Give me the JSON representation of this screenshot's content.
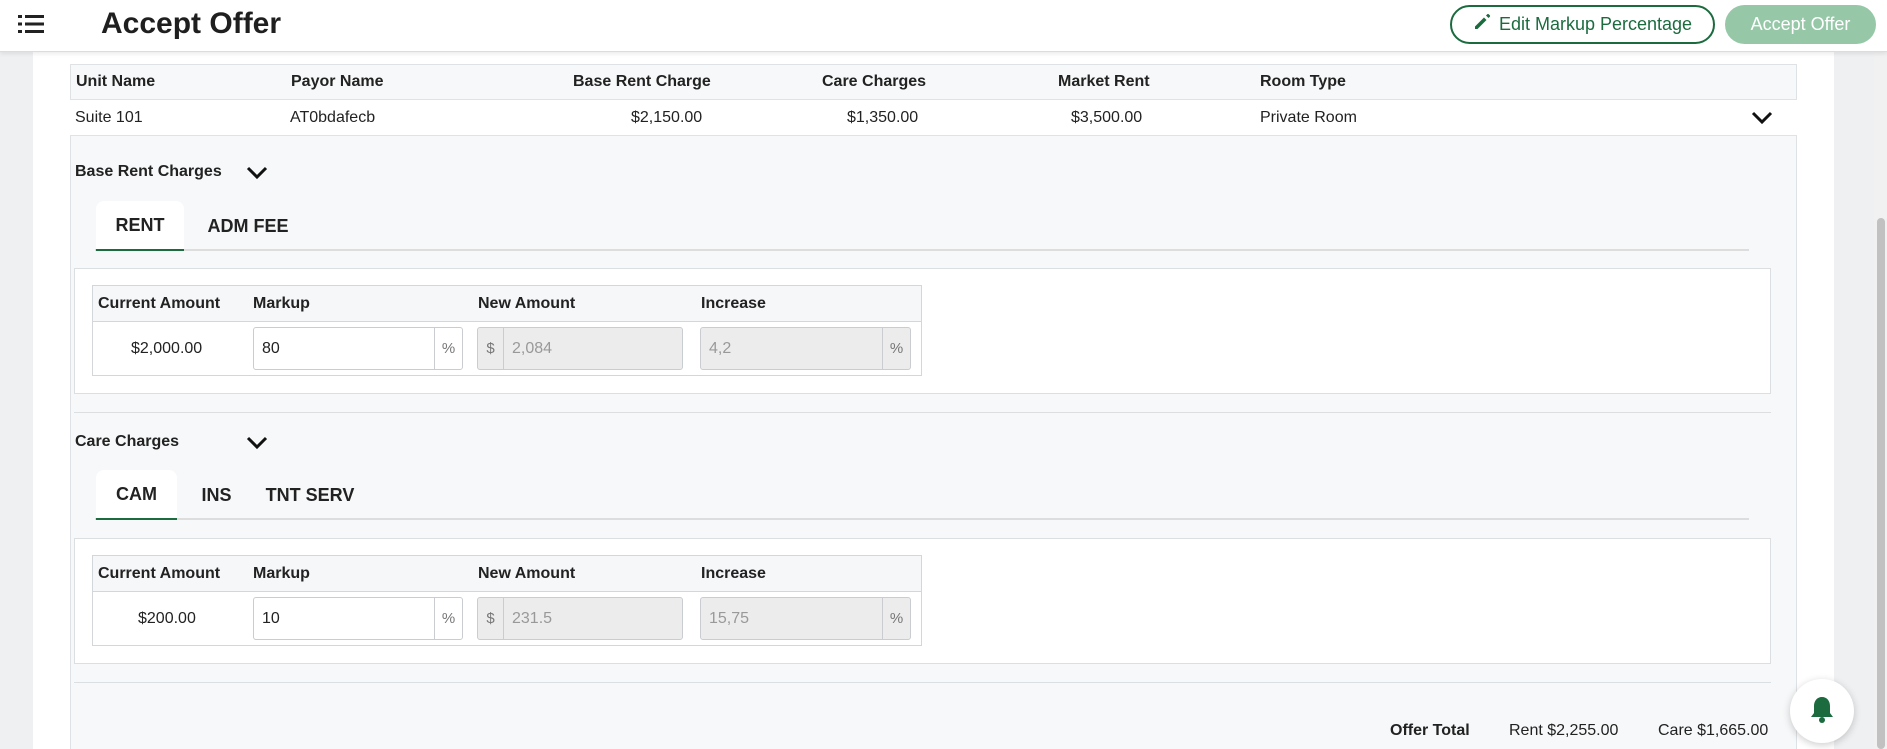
{
  "header": {
    "title": "Accept Offer",
    "edit_markup_label": "Edit Markup Percentage",
    "accept_offer_label": "Accept Offer"
  },
  "summary": {
    "columns": [
      "Unit Name",
      "Payor Name",
      "Base Rent Charge",
      "Care Charges",
      "Market Rent",
      "Room Type"
    ],
    "row": {
      "unit_name": "Suite 101",
      "payor_name": "AT0bdafecb",
      "base_rent_charge": "$2,150.00",
      "care_charges": "$1,350.00",
      "market_rent": "$3,500.00",
      "room_type": "Private Room"
    }
  },
  "base_rent": {
    "title": "Base Rent Charges",
    "tabs": [
      "RENT",
      "ADM FEE"
    ],
    "active_tab": "RENT",
    "table": {
      "headers": [
        "Current Amount",
        "Markup",
        "New Amount",
        "Increase"
      ],
      "current_amount": "$2,000.00",
      "markup": "80",
      "markup_suffix": "%",
      "new_amount_prefix": "$",
      "new_amount": "2,084",
      "increase": "4,2",
      "increase_suffix": "%"
    }
  },
  "care_charges": {
    "title": "Care Charges",
    "tabs": [
      "CAM",
      "INS",
      "TNT SERV"
    ],
    "active_tab": "CAM",
    "table": {
      "headers": [
        "Current Amount",
        "Markup",
        "New Amount",
        "Increase"
      ],
      "current_amount": "$200.00",
      "markup": "10",
      "markup_suffix": "%",
      "new_amount_prefix": "$",
      "new_amount": "231.5",
      "increase": "15,75",
      "increase_suffix": "%"
    }
  },
  "totals": {
    "label": "Offer Total",
    "rent": "Rent $2,255.00",
    "care": "Care $1,665.00"
  },
  "icons": {
    "menu": "menu-list-icon",
    "edit": "pencil-icon",
    "chevron": "chevron-down-icon",
    "bell": "bell-icon"
  },
  "colors": {
    "accent": "#1b6b3f",
    "accept_disabled": "#96c8a8"
  }
}
